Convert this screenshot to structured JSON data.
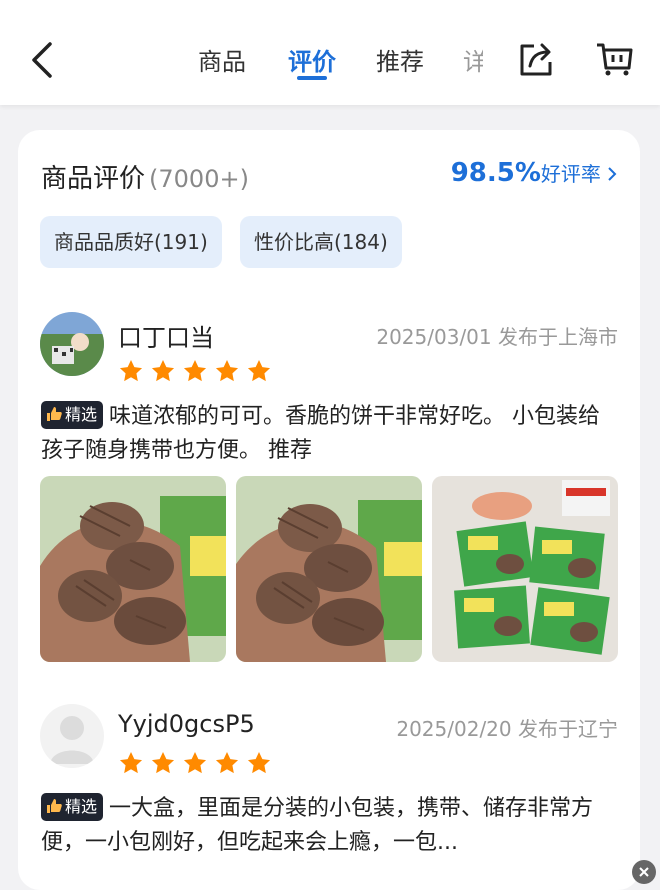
{
  "header": {
    "tabs": [
      {
        "label": "商品",
        "active": false
      },
      {
        "label": "评价",
        "active": true
      },
      {
        "label": "推荐",
        "active": false
      },
      {
        "label": "详",
        "active": false
      }
    ],
    "icons": [
      "back-icon",
      "share-icon",
      "cart-icon"
    ],
    "accent_color": "#1d6fd8"
  },
  "reviews_section": {
    "title": "商品评价",
    "count": "(7000+)",
    "rate_value": "98.5%",
    "rate_label": "好评率",
    "chips": [
      "商品品质好(191)",
      "性价比高(184)"
    ]
  },
  "reviews": [
    {
      "username": "口丁口当",
      "date": "2025/03/01",
      "location": "发布于上海市",
      "stars": 5,
      "badge": "精选",
      "text": "味道浓郁的可可。香脆的饼干非常好吃。 小包装给孩子随身携带也方便。 推荐",
      "photo_count": 3
    },
    {
      "username": "Yyjd0gcsP5",
      "date": "2025/02/20",
      "location": "发布于辽宁",
      "stars": 5,
      "badge": "精选",
      "text": "一大盒，里面是分装的小包装，携带、储存非常方便，一小包刚好，但吃起来会上瘾，一包..."
    }
  ]
}
